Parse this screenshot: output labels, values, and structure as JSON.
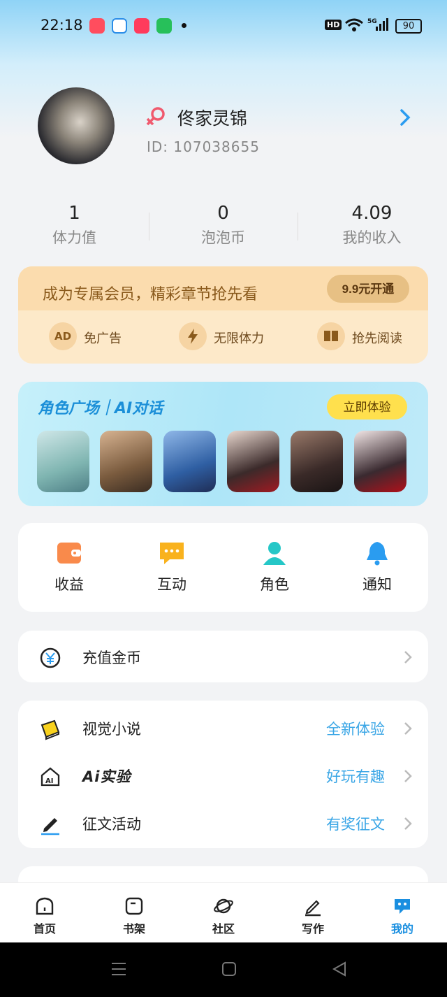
{
  "status": {
    "time": "22:18",
    "network": "5G",
    "battery": "90",
    "hd": "HD"
  },
  "profile": {
    "name": "佟家灵锦",
    "id_label": "ID:",
    "id_value": "107038655"
  },
  "stats": [
    {
      "value": "1",
      "label": "体力值"
    },
    {
      "value": "0",
      "label": "泡泡币"
    },
    {
      "value": "4.09",
      "label": "我的收入"
    }
  ],
  "vip": {
    "title": "成为专属会员，精彩章节抢先看",
    "button": "9.9元开通",
    "perks": [
      {
        "icon": "AD",
        "label": "免广告"
      },
      {
        "icon": "lightning-icon",
        "label": "无限体力"
      },
      {
        "icon": "book-icon",
        "label": "抢先阅读"
      }
    ]
  },
  "ai_banner": {
    "title": "角色广场｜AI对话",
    "button": "立即体验"
  },
  "quick": [
    {
      "label": "收益",
      "icon": "wallet-icon",
      "color": "#f98a4b"
    },
    {
      "label": "互动",
      "icon": "chat-icon",
      "color": "#f9b21d"
    },
    {
      "label": "角色",
      "icon": "person-icon",
      "color": "#25c7c7"
    },
    {
      "label": "通知",
      "icon": "bell-icon",
      "color": "#2a9cf0"
    }
  ],
  "recharge": {
    "label": "充值金币"
  },
  "menu": [
    {
      "label": "视觉小说",
      "hint": "全新体验"
    },
    {
      "label": "Ai实验",
      "hint": "好玩有趣"
    },
    {
      "label": "征文活动",
      "hint": "有奖征文"
    }
  ],
  "nav": [
    {
      "label": "首页"
    },
    {
      "label": "书架"
    },
    {
      "label": "社区"
    },
    {
      "label": "写作"
    },
    {
      "label": "我的"
    }
  ],
  "colors": {
    "accent": "#1a8fe0",
    "vip_bg": "#fde9c9",
    "hint": "#3aa6e6"
  }
}
